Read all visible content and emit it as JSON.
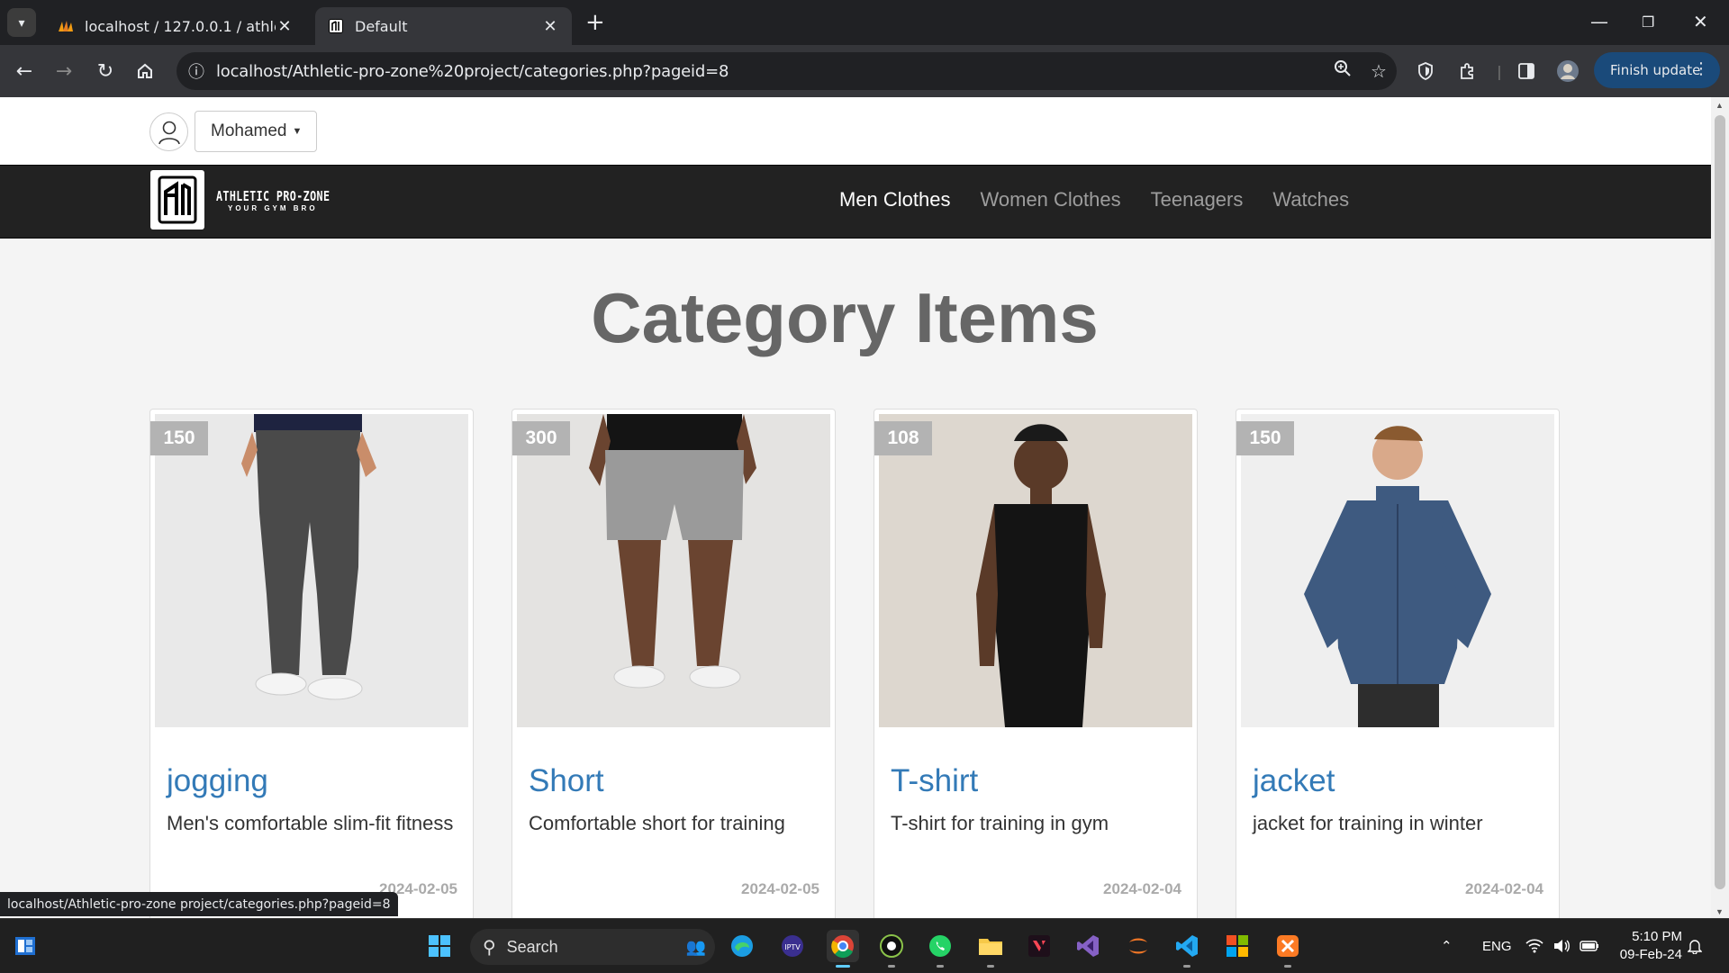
{
  "browser": {
    "tabs": [
      {
        "title": "localhost / 127.0.0.1 / athletic_p",
        "active": false
      },
      {
        "title": "Default",
        "active": true
      }
    ],
    "url": "localhost/Athletic-pro-zone%20project/categories.php?pageid=8",
    "finish_update_label": "Finish update",
    "status_url": "localhost/Athletic-pro-zone project/categories.php?pageid=8"
  },
  "userbar": {
    "username": "Mohamed"
  },
  "navbar": {
    "brand_title": "ATHLETIC PRO-ZONE",
    "brand_tagline": "YOUR GYM BRO",
    "links": [
      {
        "label": "Men Clothes",
        "active": true
      },
      {
        "label": "Women Clothes",
        "active": false
      },
      {
        "label": "Teenagers",
        "active": false
      },
      {
        "label": "Watches",
        "active": false
      }
    ]
  },
  "page": {
    "title": "Category Items"
  },
  "items": [
    {
      "price": "150",
      "name": "jogging",
      "desc": "Men's comfortable slim-fit fitness",
      "date": "2024-02-05",
      "image": "model-jogging-pants"
    },
    {
      "price": "300",
      "name": "Short",
      "desc": "Comfortable short for training",
      "date": "2024-02-05",
      "image": "model-shorts"
    },
    {
      "price": "108",
      "name": "T-shirt",
      "desc": "T-shirt for training in gym",
      "date": "2024-02-04",
      "image": "model-sleeveless-tshirt"
    },
    {
      "price": "150",
      "name": "jacket",
      "desc": "jacket for training in winter",
      "date": "2024-02-04",
      "image": "model-fleece-jacket"
    }
  ],
  "taskbar": {
    "search_label": "Search",
    "language": "ENG",
    "time": "5:10 PM",
    "date": "09-Feb-24"
  },
  "colors": {
    "link_blue": "#337ab7",
    "navbar_bg": "#222222",
    "price_badge": "#b3b3b3"
  }
}
